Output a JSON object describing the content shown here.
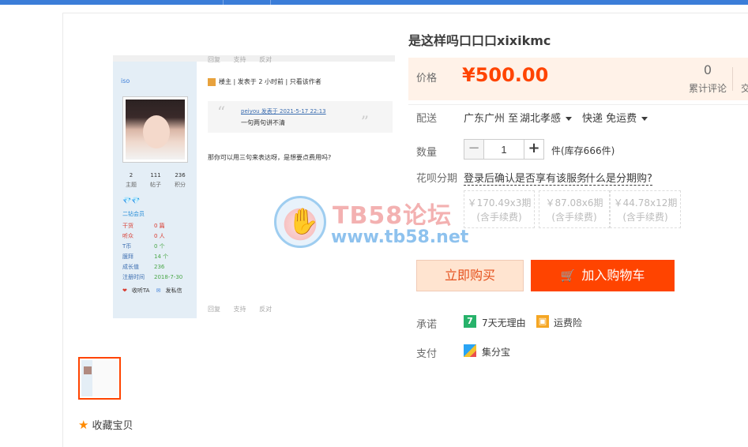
{
  "product": {
    "title": "是这样吗⼝⼝⼝xixikmc",
    "price_label": "价格",
    "price": "¥500.00",
    "review_count": "0",
    "review_label": "累计评论",
    "deal_label_partial": "交"
  },
  "delivery": {
    "label": "配送",
    "from": "广东广州 至",
    "to": "湖北孝感",
    "method": "快递 免运费"
  },
  "quantity": {
    "label": "数量",
    "value": "1",
    "minus": "−",
    "plus": "+",
    "stock_text": "件(库存666件)"
  },
  "huabei": {
    "label": "花呗分期",
    "login_link": "登录后确认是否享有该服务",
    "what_link": "什么是分期购?",
    "options": [
      {
        "amount": "￥170.49x3期",
        "fee": "(含手续费)"
      },
      {
        "amount": "￥87.08x6期",
        "fee": "(含手续费)"
      },
      {
        "amount": "￥44.78x12期",
        "fee": "(含手续费)"
      }
    ]
  },
  "actions": {
    "buy_now": "立即购买",
    "add_to_cart": "加入购物车"
  },
  "promise": {
    "label": "承诺",
    "items": [
      "7天无理由",
      "运费险"
    ],
    "icon_seven": "7"
  },
  "payment": {
    "label": "支付",
    "method": "集分宝"
  },
  "favorite": {
    "label": "收藏宝贝"
  },
  "watermark": {
    "title": "TB58论坛",
    "url": "www.tb58.net"
  },
  "image_content": {
    "username": "iso",
    "toolbar": [
      "回复",
      "支持",
      "反对"
    ],
    "post_meta": [
      "楼主",
      "发表于 2 小时前",
      "只看该作者"
    ],
    "quote_author": "peiyou 发表于 2021-5-17 22:13",
    "quote_text": "一句两句讲不清",
    "body_text": "那你可以用三句来表达呀，是想要点费用吗?",
    "stats": [
      {
        "value": "2",
        "label": "主题"
      },
      {
        "value": "111",
        "label": "帖子"
      },
      {
        "value": "236",
        "label": "积分"
      }
    ],
    "level": "二钻会员",
    "info": [
      {
        "key": "干货",
        "value": "0 篇"
      },
      {
        "key": "听众",
        "value": "0 人"
      },
      {
        "key": "T币",
        "value": "0 个"
      },
      {
        "key": "膜拜",
        "value": "14 个"
      },
      {
        "key": "成长值",
        "value": "236"
      },
      {
        "key": "注册时间",
        "value": "2018-7-30"
      }
    ],
    "follow": "收听TA",
    "message": "发私信"
  }
}
